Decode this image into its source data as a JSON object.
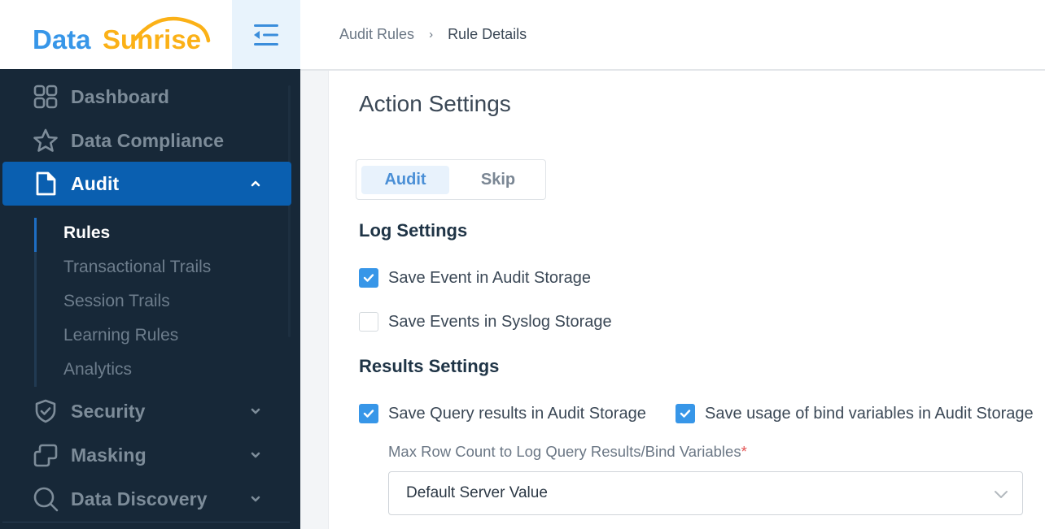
{
  "brand": {
    "name_part1": "Data",
    "name_part2": "Sunrise",
    "color_primary": "#3796e8",
    "color_secondary": "#fbb117"
  },
  "sidebar": {
    "items": [
      {
        "label": "Dashboard",
        "icon": "dashboard-icon",
        "active": false,
        "expandable": false
      },
      {
        "label": "Data Compliance",
        "icon": "star-icon",
        "active": false,
        "expandable": false
      },
      {
        "label": "Audit",
        "icon": "document-icon",
        "active": true,
        "expandable": true,
        "expanded": true
      },
      {
        "label": "Security",
        "icon": "shield-check-icon",
        "active": false,
        "expandable": true
      },
      {
        "label": "Masking",
        "icon": "masking-icon",
        "active": false,
        "expandable": true
      },
      {
        "label": "Data Discovery",
        "icon": "search-icon",
        "active": false,
        "expandable": true
      }
    ],
    "audit_subitems": [
      {
        "label": "Rules",
        "active": true
      },
      {
        "label": "Transactional Trails",
        "active": false
      },
      {
        "label": "Session Trails",
        "active": false
      },
      {
        "label": "Learning Rules",
        "active": false
      },
      {
        "label": "Analytics",
        "active": false
      }
    ]
  },
  "header": {
    "breadcrumb": [
      {
        "label": "Audit Rules"
      },
      {
        "label": "Rule Details"
      }
    ]
  },
  "main": {
    "title": "Action Settings",
    "action_toggle": {
      "options": [
        "Audit",
        "Skip"
      ],
      "selected": "Audit"
    },
    "log_settings": {
      "title": "Log Settings",
      "options": [
        {
          "label": "Save Event in Audit Storage",
          "checked": true
        },
        {
          "label": "Save Events in Syslog Storage",
          "checked": false
        }
      ]
    },
    "results_settings": {
      "title": "Results Settings",
      "options": [
        {
          "label": "Save Query results in Audit Storage",
          "checked": true
        },
        {
          "label": "Save usage of bind variables in Audit Storage",
          "checked": true
        }
      ],
      "max_row_count": {
        "label": "Max Row Count to Log Query Results/Bind Variables",
        "required_mark": "*",
        "value": "Default Server Value"
      }
    }
  }
}
